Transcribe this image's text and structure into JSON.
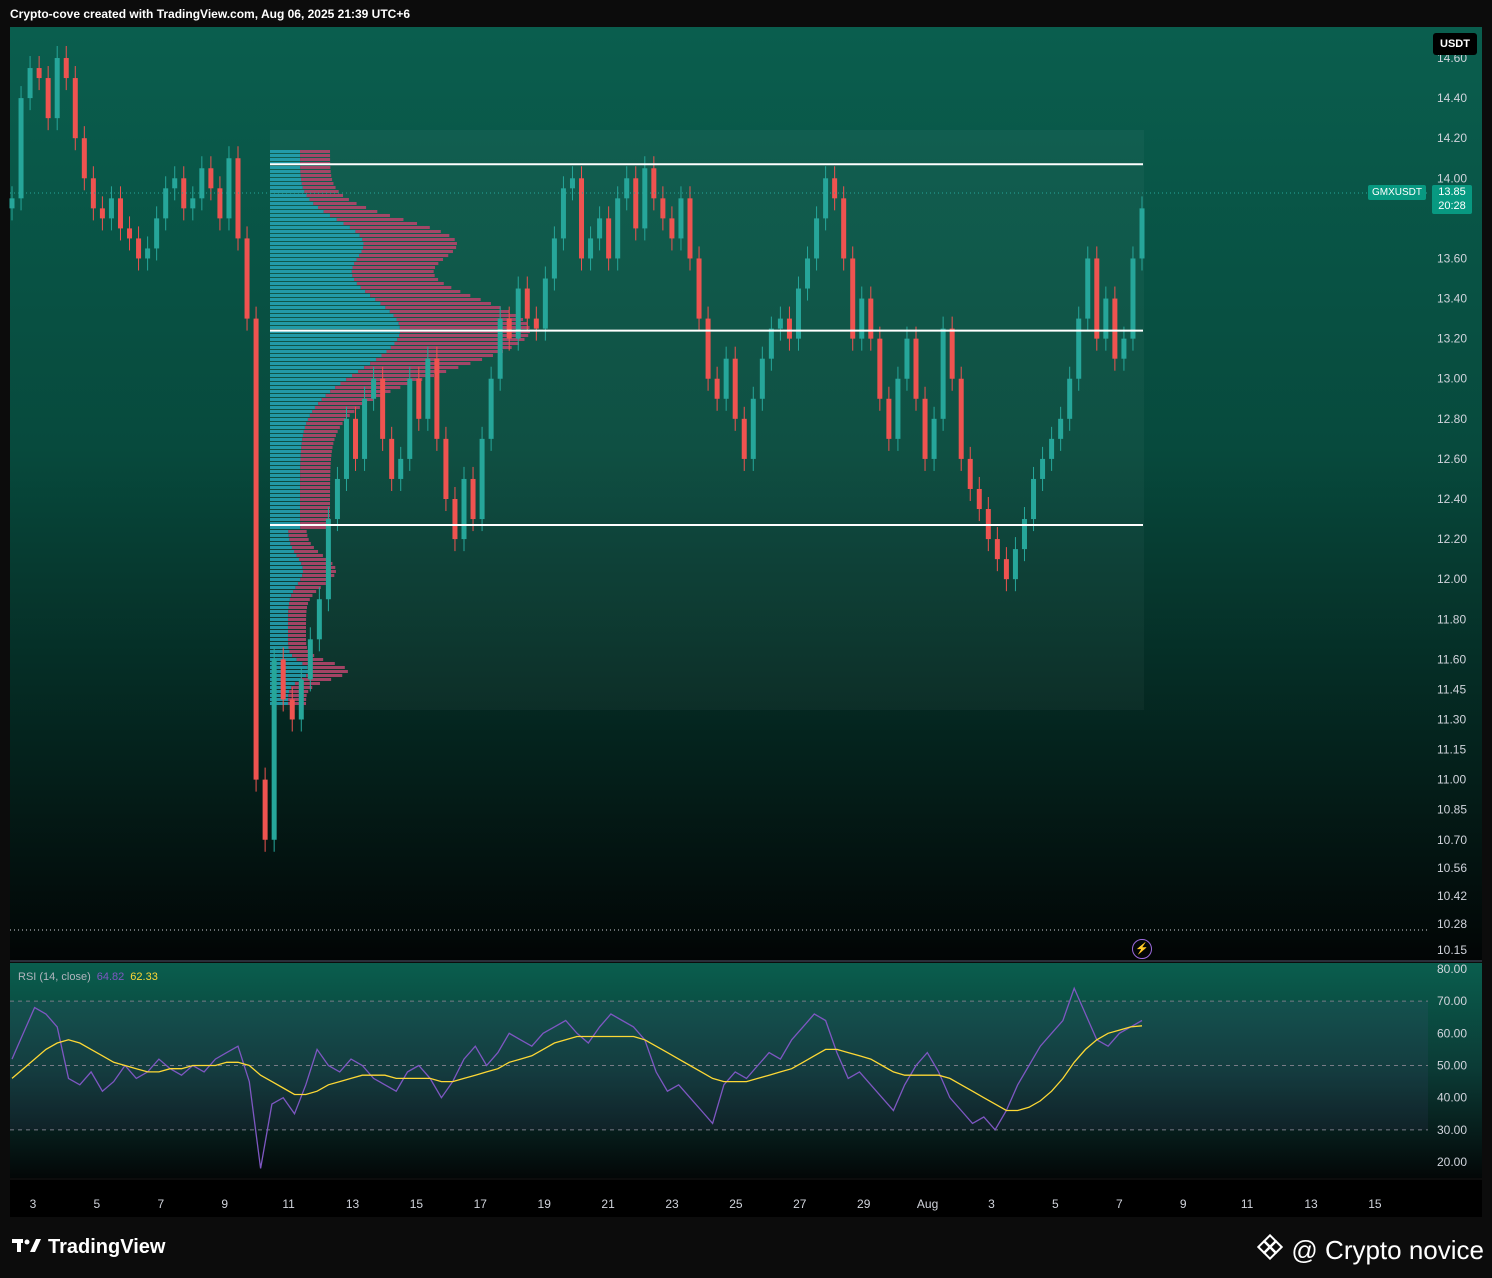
{
  "header": {
    "text": "Crypto-cove created with TradingView.com, Aug 06, 2025 21:39 UTC+6"
  },
  "symbol": {
    "name": "GMXUSDT",
    "price": "13.85",
    "countdown": "20:28",
    "currency": "USDT"
  },
  "price_axis": {
    "ticks": [
      "14.60",
      "14.40",
      "14.20",
      "14.00",
      "13.60",
      "13.40",
      "13.20",
      "13.00",
      "12.80",
      "12.60",
      "12.40",
      "12.20",
      "12.00",
      "11.80",
      "11.60",
      "11.45",
      "11.30",
      "11.15",
      "11.00",
      "10.85",
      "10.70",
      "10.56",
      "10.42",
      "10.28",
      "10.15"
    ]
  },
  "rsi": {
    "label": "RSI (14, close)",
    "rsi_value": "64.82",
    "ma_value": "62.33",
    "ticks": [
      "80.00",
      "70.00",
      "60.00",
      "50.00",
      "40.00",
      "30.00",
      "20.00"
    ],
    "bands": {
      "upper": 70,
      "middle": 50,
      "lower": 30
    }
  },
  "time_axis": {
    "ticks": [
      "3",
      "5",
      "7",
      "9",
      "11",
      "13",
      "15",
      "17",
      "19",
      "21",
      "23",
      "25",
      "27",
      "29",
      "Aug",
      "3",
      "5",
      "7",
      "9",
      "11",
      "13",
      "15"
    ]
  },
  "footer": {
    "brand": "TradingView",
    "author": "@ Crypto novice"
  },
  "colors": {
    "up": "#26a69a",
    "down": "#ef5350",
    "rsi_line": "#7e57c2",
    "rsi_ma": "#fdd835",
    "vp_up": "#26a6b8",
    "vp_down": "#b2456a",
    "level_line": "#ffffff"
  },
  "chart_data": [
    {
      "type": "candlestick",
      "symbol": "GMXUSDT",
      "ylim": [
        10.15,
        14.65
      ],
      "horizontal_levels": [
        14.07,
        13.24,
        12.27
      ],
      "last_price": 13.85,
      "close_series": [
        13.9,
        14.4,
        14.55,
        14.5,
        14.3,
        14.6,
        14.5,
        14.2,
        14.0,
        13.85,
        13.8,
        13.9,
        13.75,
        13.7,
        13.6,
        13.65,
        13.8,
        13.95,
        14.0,
        13.85,
        13.9,
        14.05,
        13.95,
        13.8,
        14.1,
        13.7,
        13.3,
        11.0,
        10.7,
        11.6,
        11.4,
        11.3,
        11.5,
        11.7,
        11.9,
        12.3,
        12.5,
        12.8,
        12.6,
        12.9,
        13.0,
        12.7,
        12.5,
        12.6,
        13.0,
        12.8,
        13.1,
        12.7,
        12.4,
        12.2,
        12.5,
        12.3,
        12.7,
        13.0,
        13.3,
        13.2,
        13.45,
        13.3,
        13.25,
        13.5,
        13.7,
        13.95,
        14.0,
        13.6,
        13.7,
        13.8,
        13.6,
        13.9,
        14.0,
        13.75,
        14.05,
        13.9,
        13.8,
        13.7,
        13.9,
        13.6,
        13.3,
        13.0,
        12.9,
        13.1,
        12.8,
        12.6,
        12.9,
        13.1,
        13.25,
        13.3,
        13.2,
        13.45,
        13.6,
        13.8,
        14.0,
        13.9,
        13.6,
        13.2,
        13.4,
        13.2,
        12.9,
        12.7,
        13.0,
        13.2,
        12.9,
        12.6,
        12.8,
        13.25,
        13.0,
        12.6,
        12.45,
        12.35,
        12.2,
        12.1,
        12.0,
        12.15,
        12.3,
        12.5,
        12.6,
        12.7,
        12.8,
        13.0,
        13.3,
        13.6,
        13.2,
        13.4,
        13.1,
        13.2,
        13.6,
        13.85
      ],
      "rsi_series": [
        52,
        60,
        68,
        66,
        62,
        46,
        44,
        48,
        42,
        45,
        50,
        46,
        48,
        52,
        49,
        47,
        50,
        48,
        52,
        54,
        56,
        45,
        18,
        38,
        40,
        35,
        44,
        55,
        50,
        48,
        52,
        50,
        46,
        44,
        42,
        48,
        50,
        46,
        40,
        45,
        52,
        56,
        50,
        54,
        60,
        58,
        56,
        60,
        62,
        64,
        60,
        57,
        62,
        66,
        64,
        62,
        58,
        48,
        42,
        44,
        40,
        36,
        32,
        44,
        48,
        46,
        50,
        54,
        52,
        58,
        62,
        66,
        64,
        54,
        46,
        48,
        44,
        40,
        36,
        44,
        50,
        54,
        48,
        40,
        36,
        32,
        34,
        30,
        36,
        44,
        50,
        56,
        60,
        64,
        74,
        66,
        58,
        56,
        60,
        62,
        64
      ],
      "rsi_ma_series": [
        46,
        49,
        52,
        55,
        57,
        58,
        57,
        55,
        53,
        51,
        50,
        49,
        48,
        48,
        49,
        49,
        50,
        50,
        50,
        51,
        51,
        50,
        47,
        45,
        43,
        41,
        41,
        42,
        44,
        45,
        46,
        47,
        47,
        47,
        46,
        46,
        46,
        46,
        45,
        45,
        46,
        47,
        48,
        49,
        51,
        52,
        53,
        55,
        57,
        58,
        59,
        59,
        59,
        59,
        59,
        59,
        58,
        56,
        54,
        52,
        50,
        48,
        46,
        45,
        45,
        45,
        46,
        47,
        48,
        49,
        51,
        53,
        55,
        55,
        54,
        53,
        52,
        50,
        48,
        47,
        47,
        47,
        47,
        46,
        44,
        42,
        40,
        38,
        36,
        36,
        37,
        39,
        42,
        46,
        51,
        55,
        58,
        60,
        61,
        62,
        62.33
      ]
    }
  ]
}
